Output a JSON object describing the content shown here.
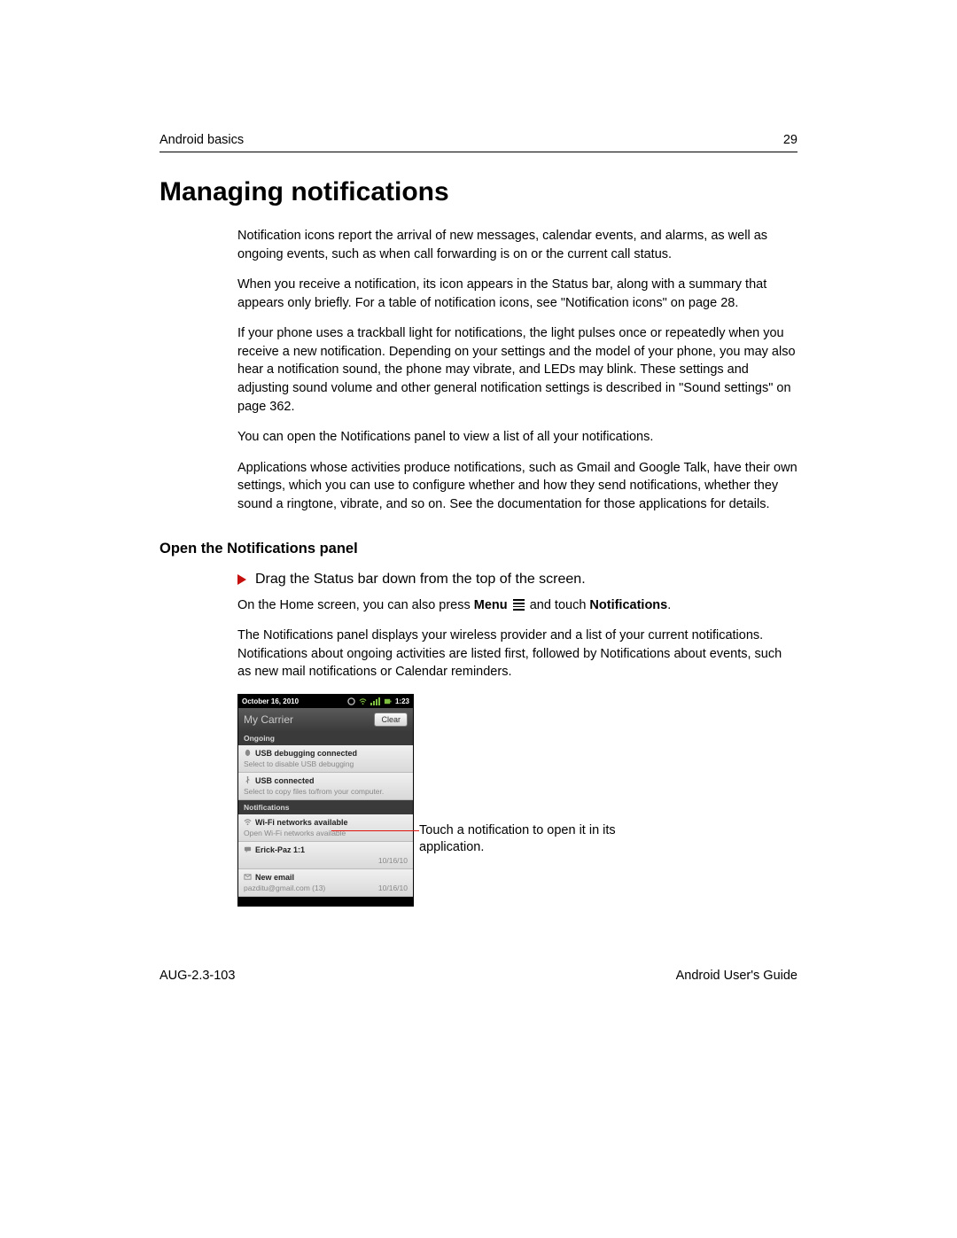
{
  "header": {
    "section": "Android basics",
    "page_num": "29"
  },
  "title": "Managing notifications",
  "paras": [
    "Notification icons report the arrival of new messages, calendar events, and alarms, as well as ongoing events, such as when call forwarding is on or the current call status.",
    "When you receive a notification, its icon appears in the Status bar, along with a summary that appears only briefly. For a table of notification icons, see \"Notification icons\" on page 28.",
    "If your phone uses a trackball light for notifications, the light pulses once or repeatedly when you receive a new notification. Depending on your settings and the model of your phone, you may also hear a notification sound, the phone may vibrate, and LEDs may blink. These settings and adjusting sound volume and other general notification settings is described in \"Sound settings\" on page 362.",
    "You can open the Notifications panel to view a list of all your notifications.",
    "Applications whose activities produce notifications, such as Gmail and Google Talk, have their own settings, which you can use to configure whether and how they send notifications, whether they sound a ringtone, vibrate, and so on. See the documentation for those applications for details."
  ],
  "subheading": "Open the Notifications panel",
  "step": "Drag the Status bar down from the top of the screen.",
  "sub_paras": {
    "line_pre": "On the Home screen, you can also press ",
    "menu_word": "Menu",
    "line_mid": " and touch ",
    "notif_word": "Notifications",
    "line_post": ".",
    "desc": "The Notifications panel displays your wireless provider and a list of your current notifications. Notifications about ongoing activities are listed first, followed by Notifications about events, such as new mail notifications or Calendar reminders."
  },
  "phone": {
    "date": "October 16, 2010",
    "time": "1:23",
    "carrier": "My Carrier",
    "clear": "Clear",
    "sec_ongoing": "Ongoing",
    "sec_notifications": "Notifications",
    "items": {
      "usb_debug_title": "USB debugging connected",
      "usb_debug_sub": "Select to disable USB debugging",
      "usb_conn_title": "USB connected",
      "usb_conn_sub": "Select to copy files to/from your computer.",
      "wifi_title": "Wi-Fi networks available",
      "wifi_sub": "Open Wi-Fi networks available",
      "chat_title": "Erick-Paz 1:1",
      "chat_date": "10/16/10",
      "mail_title": "New email",
      "mail_sub": "pazditu@gmail.com (13)",
      "mail_date": "10/16/10"
    }
  },
  "callout": "Touch a notification to open it in its application.",
  "footer": {
    "left": "AUG-2.3-103",
    "right": "Android User's Guide"
  }
}
